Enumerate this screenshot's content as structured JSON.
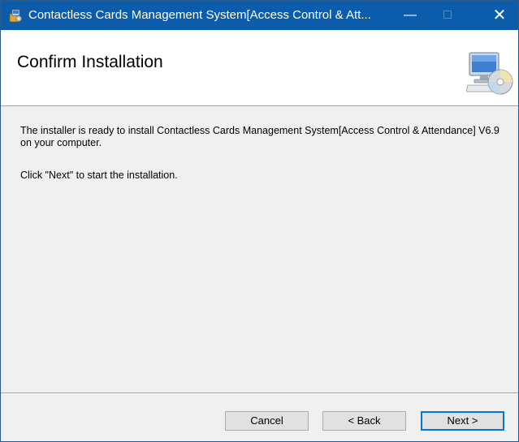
{
  "window": {
    "title": "Contactless Cards Management System[Access Control & Att...",
    "minimize_glyph": "—",
    "maximize_glyph": "□",
    "close_glyph": "✕"
  },
  "header": {
    "title": "Confirm Installation",
    "icon": "computer-cd-icon"
  },
  "body": {
    "paragraph1": "The installer is ready to install Contactless Cards Management System[Access Control & Attendance] V6.9 on your computer.",
    "paragraph2": "Click \"Next\" to start the installation."
  },
  "buttons": {
    "cancel": "Cancel",
    "back": "< Back",
    "next": "Next >"
  },
  "colors": {
    "titlebar": "#0b5cab",
    "focus_border": "#0078d7"
  }
}
